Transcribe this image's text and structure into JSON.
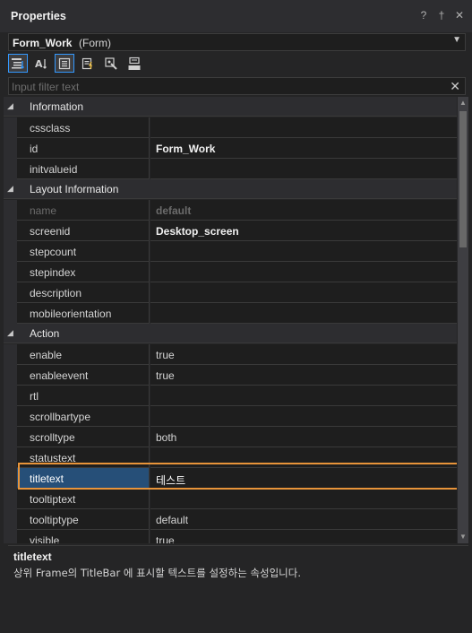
{
  "panel": {
    "title": "Properties",
    "icons": [
      "help-icon",
      "pin-icon",
      "close-icon"
    ],
    "help_glyph": "?",
    "pin_glyph": "†",
    "close_glyph": "✕"
  },
  "object_selector": {
    "name": "Form_Work",
    "type": "(Form)"
  },
  "toolbar": {
    "buttons": [
      "categorized-view-icon",
      "alphabetical-sort-icon",
      "properties-view-icon",
      "events-view-icon",
      "style-icon",
      "init-icon"
    ]
  },
  "filter": {
    "placeholder": "Input filter text",
    "value": ""
  },
  "grid": {
    "categories": {
      "information": "Information",
      "layout": "Layout Information",
      "action": "Action"
    },
    "rows": {
      "cssclass": {
        "name": "cssclass",
        "value": ""
      },
      "id": {
        "name": "id",
        "value": "Form_Work"
      },
      "initvalueid": {
        "name": "initvalueid",
        "value": ""
      },
      "name": {
        "name": "name",
        "value": "default"
      },
      "screenid": {
        "name": "screenid",
        "value": "Desktop_screen"
      },
      "stepcount": {
        "name": "stepcount",
        "value": ""
      },
      "stepindex": {
        "name": "stepindex",
        "value": ""
      },
      "description": {
        "name": "description",
        "value": ""
      },
      "mobileorientation": {
        "name": "mobileorientation",
        "value": ""
      },
      "enable": {
        "name": "enable",
        "value": "true"
      },
      "enableevent": {
        "name": "enableevent",
        "value": "true"
      },
      "rtl": {
        "name": "rtl",
        "value": ""
      },
      "scrollbartype": {
        "name": "scrollbartype",
        "value": ""
      },
      "scrolltype": {
        "name": "scrolltype",
        "value": "both"
      },
      "statustext": {
        "name": "statustext",
        "value": ""
      },
      "titletext": {
        "name": "titletext",
        "value": "테스트"
      },
      "tooltiptext": {
        "name": "tooltiptext",
        "value": ""
      },
      "tooltiptype": {
        "name": "tooltiptype",
        "value": "default"
      },
      "visible": {
        "name": "visible",
        "value": "true"
      }
    }
  },
  "description": {
    "title": "titletext",
    "text": "상위 Frame의 TitleBar 에 표시할 텍스트를 설정하는 속성입니다."
  },
  "colors": {
    "accent": "#3399ff",
    "highlight": "#e8943a",
    "selected_row": "#264f78"
  }
}
